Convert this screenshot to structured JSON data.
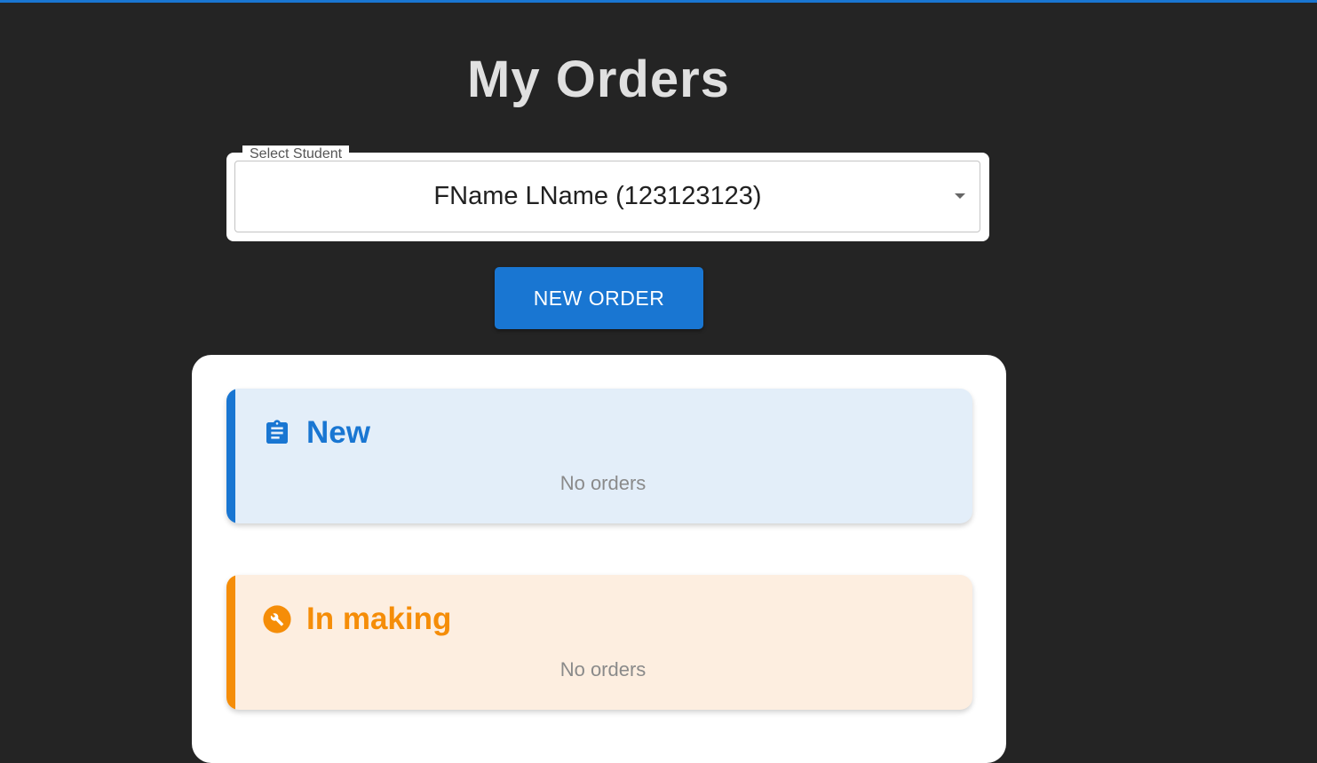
{
  "page": {
    "title": "My Orders"
  },
  "student_select": {
    "label": "Select Student",
    "value": "FName LName (123123123)"
  },
  "actions": {
    "new_order_label": "NEW ORDER"
  },
  "status_groups": [
    {
      "title": "New",
      "icon": "clipboard-icon",
      "color": "#1976d2",
      "empty_text": "No orders"
    },
    {
      "title": "In making",
      "icon": "wrench-icon",
      "color": "#f58d08",
      "empty_text": "No orders"
    }
  ],
  "colors": {
    "background": "#242424",
    "accent": "#1976d2",
    "in_making": "#f58d08"
  }
}
